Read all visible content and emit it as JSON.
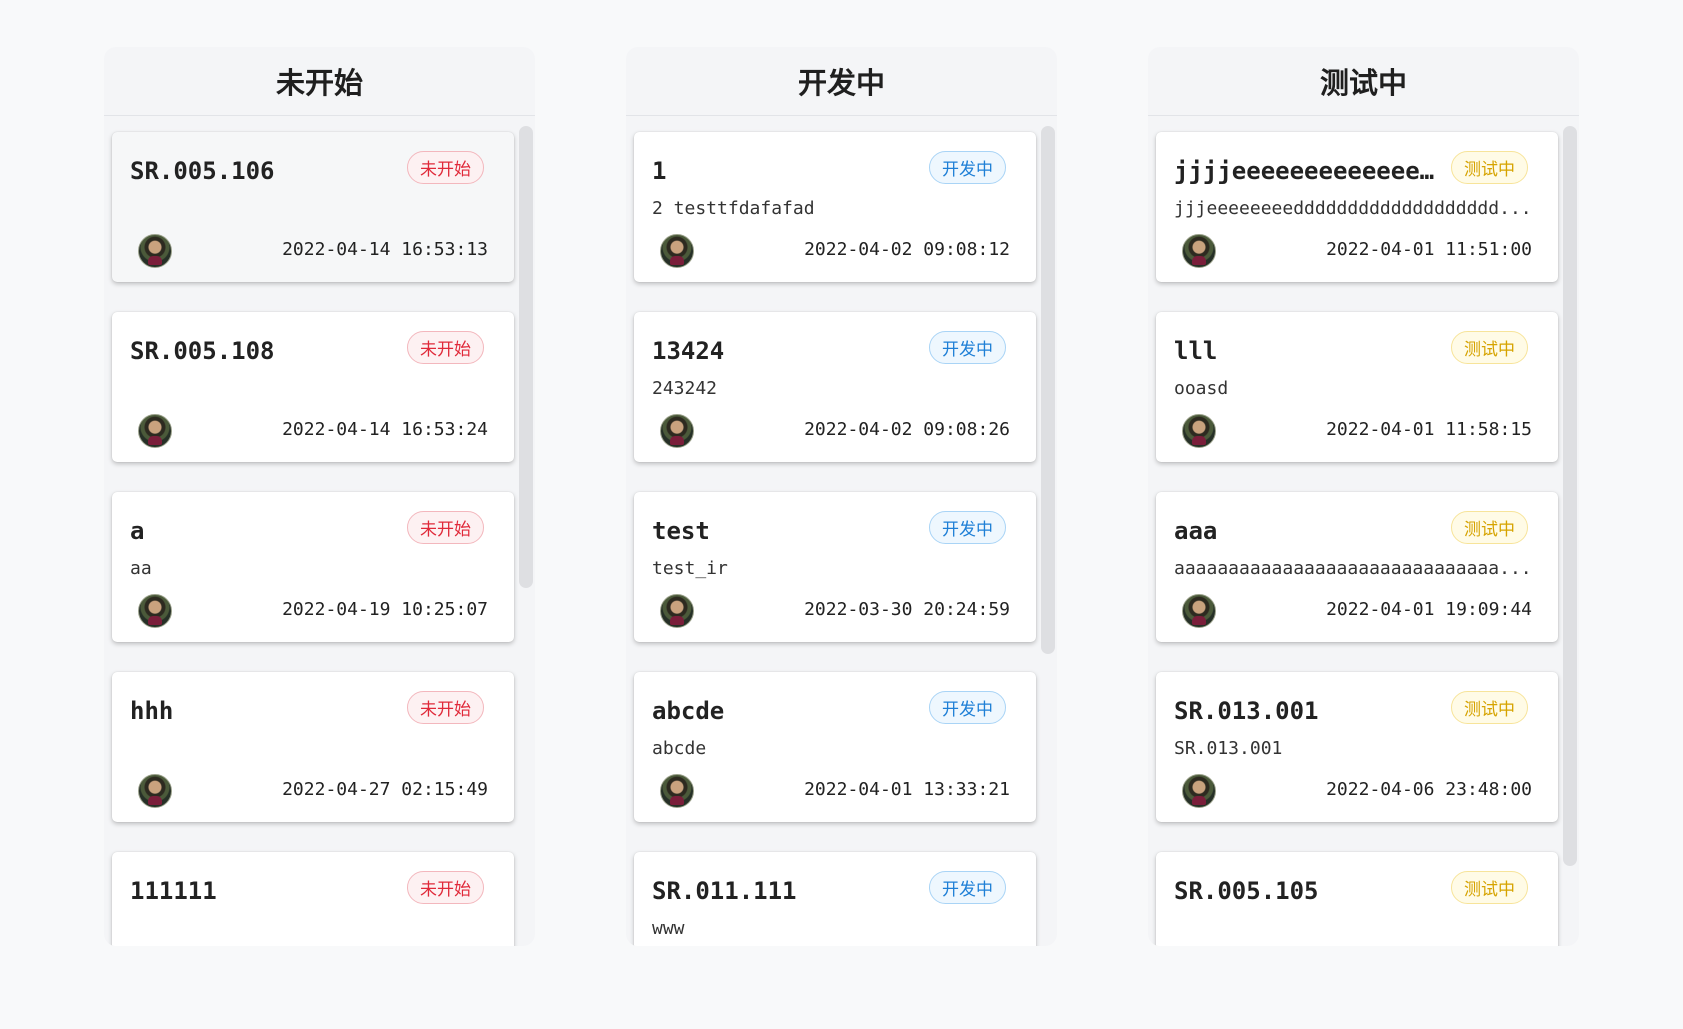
{
  "columns": [
    {
      "title": "未开始",
      "badge_color": "#e02a3a",
      "cards": [
        {
          "title": "SR.005.106",
          "status": "未开始",
          "desc": "",
          "time": "2022-04-14 16:53:13"
        },
        {
          "title": "SR.005.108",
          "status": "未开始",
          "desc": "",
          "time": "2022-04-14 16:53:24"
        },
        {
          "title": "a",
          "status": "未开始",
          "desc": "aa",
          "time": "2022-04-19 10:25:07"
        },
        {
          "title": "hhh",
          "status": "未开始",
          "desc": "",
          "time": "2022-04-27 02:15:49"
        },
        {
          "title": "111111",
          "status": "未开始",
          "desc": "",
          "time": ""
        }
      ]
    },
    {
      "title": "开发中",
      "badge_color": "#1e7fd6",
      "cards": [
        {
          "title": "1",
          "status": "开发中",
          "desc": "2 testtfdafafad",
          "time": "2022-04-02 09:08:12"
        },
        {
          "title": "13424",
          "status": "开发中",
          "desc": "243242",
          "time": "2022-04-02 09:08:26"
        },
        {
          "title": "test",
          "status": "开发中",
          "desc": "test_ir",
          "time": "2022-03-30 20:24:59"
        },
        {
          "title": "abcde",
          "status": "开发中",
          "desc": "abcde",
          "time": "2022-04-01 13:33:21"
        },
        {
          "title": "SR.011.111",
          "status": "开发中",
          "desc": "www",
          "time": ""
        }
      ]
    },
    {
      "title": "测试中",
      "badge_color": "#d6a300",
      "cards": [
        {
          "title": "jjjjeeeeeeeeeeeee...",
          "status": "测试中",
          "desc": "jjjeeeeeeeeddddddddddddddddddd...",
          "time": "2022-04-01 11:51:00"
        },
        {
          "title": "lll",
          "status": "测试中",
          "desc": "ooasd",
          "time": "2022-04-01 11:58:15"
        },
        {
          "title": "aaa",
          "status": "测试中",
          "desc": "aaaaaaaaaaaaaaaaaaaaaaaaaaaaaa...",
          "time": "2022-04-01 19:09:44"
        },
        {
          "title": "SR.013.001",
          "status": "测试中",
          "desc": "SR.013.001",
          "time": "2022-04-06 23:48:00"
        },
        {
          "title": "SR.005.105",
          "status": "测试中",
          "desc": "",
          "time": ""
        }
      ]
    }
  ]
}
